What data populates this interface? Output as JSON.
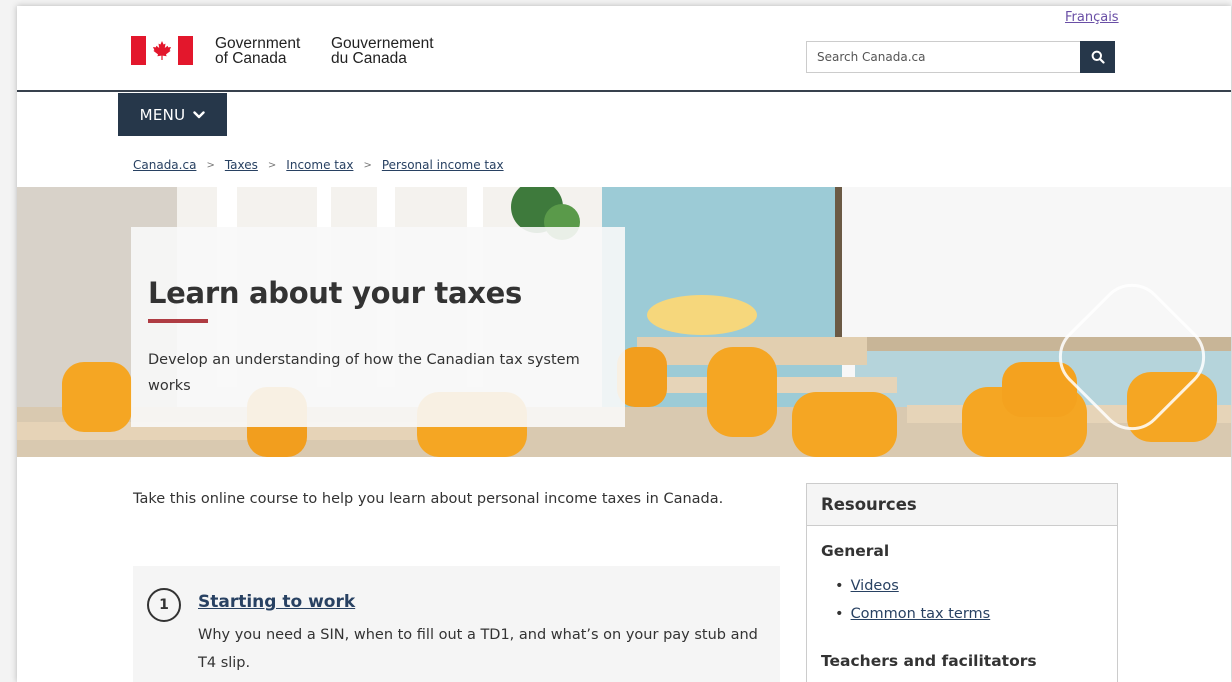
{
  "header": {
    "language_link": "Français",
    "signature_en": [
      "Government",
      "of Canada"
    ],
    "signature_fr": [
      "Gouvernement",
      "du Canada"
    ],
    "search_placeholder": "Search Canada.ca"
  },
  "menu": {
    "label": "MENU"
  },
  "breadcrumb": [
    "Canada.ca",
    "Taxes",
    "Income tax",
    "Personal income tax"
  ],
  "hero": {
    "title": "Learn about your taxes",
    "subtitle": "Develop an understanding of how the Canadian tax system works"
  },
  "intro": "Take this online course to help you learn about personal income taxes in Canada.",
  "steps": [
    {
      "number": "1",
      "title": "Starting to work",
      "description": "Why you need a SIN, when to fill out a TD1, and what’s on your pay stub and T4 slip."
    }
  ],
  "resources": {
    "heading": "Resources",
    "general_heading": "General",
    "general_links": [
      "Videos",
      "Common tax terms"
    ],
    "teachers_heading": "Teachers and facilitators"
  },
  "colors": {
    "brand_navy": "#26374a",
    "flag_red": "#e3172c",
    "accent_red": "#af3c43",
    "link": "#284162"
  },
  "icons": [
    "canada-flag-icon",
    "search-icon",
    "chevron-down-icon"
  ]
}
